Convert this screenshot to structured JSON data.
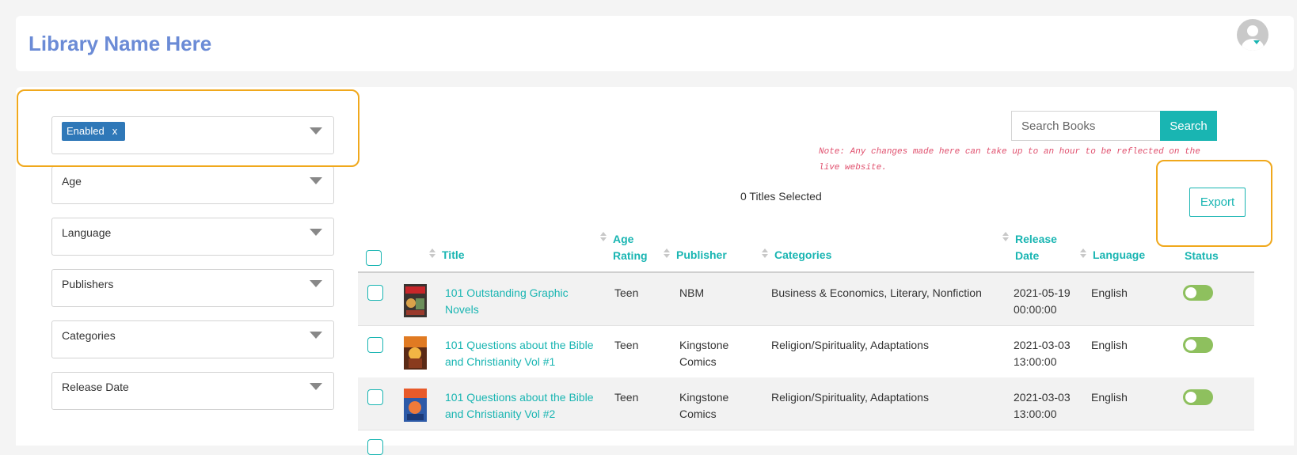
{
  "header": {
    "library_name": "Library Name Here"
  },
  "filters": {
    "status_chip": "Enabled",
    "chip_remove": "x",
    "age": "Age",
    "language": "Language",
    "publishers": "Publishers",
    "categories": "Categories",
    "release_date": "Release Date"
  },
  "search": {
    "placeholder": "Search Books",
    "button": "Search"
  },
  "note": "Note: Any changes made here can take up to an hour to be reflected on the live website.",
  "selection": {
    "count_text": "0 Titles Selected"
  },
  "export_label": "Export",
  "table": {
    "columns": {
      "title": "Title",
      "age_rating": "Age Rating",
      "publisher": "Publisher",
      "categories": "Categories",
      "release_date": "Release Date",
      "language": "Language",
      "status": "Status"
    },
    "rows": [
      {
        "title": "101 Outstanding Graphic Novels",
        "age": "Teen",
        "publisher": "NBM",
        "categories": "Business & Economics, Literary, Nonfiction",
        "release_date": "2021-05-19 00:00:00",
        "language": "English",
        "status_enabled": true
      },
      {
        "title": "101 Questions about the Bible and Christianity Vol #1",
        "age": "Teen",
        "publisher": "Kingstone Comics",
        "categories": "Religion/Spirituality, Adaptations",
        "release_date": "2021-03-03 13:00:00",
        "language": "English",
        "status_enabled": true
      },
      {
        "title": "101 Questions about the Bible and Christianity Vol #2",
        "age": "Teen",
        "publisher": "Kingstone Comics",
        "categories": "Religion/Spirituality, Adaptations",
        "release_date": "2021-03-03 13:00:00",
        "language": "English",
        "status_enabled": true
      }
    ]
  },
  "colors": {
    "accent": "#19b5b2",
    "title_blue": "#6b8bd6",
    "highlight": "#f0a81c",
    "note_pink": "#e0506e",
    "toggle_on": "#8ec05e",
    "chip_blue": "#2f78b8"
  }
}
